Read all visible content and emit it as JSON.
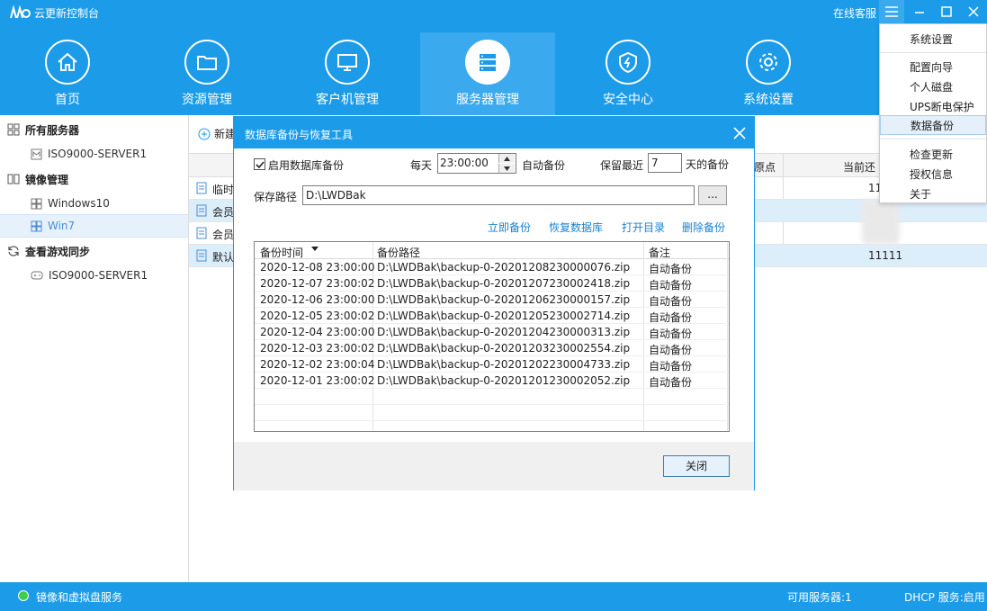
{
  "app": {
    "title": "云更新控制台",
    "online_service": "在线客服"
  },
  "nav": [
    {
      "label": "首页",
      "icon": "home-icon"
    },
    {
      "label": "资源管理",
      "icon": "folder-icon"
    },
    {
      "label": "客户机管理",
      "icon": "monitor-icon"
    },
    {
      "label": "服务器管理",
      "icon": "server-icon",
      "active": true
    },
    {
      "label": "安全中心",
      "icon": "shield-icon"
    },
    {
      "label": "系统设置",
      "icon": "gear-icon"
    }
  ],
  "sidebar": {
    "items": [
      {
        "label": "所有服务器",
        "type": "group"
      },
      {
        "label": "ISO9000-SERVER1",
        "type": "child"
      },
      {
        "label": "镜像管理",
        "type": "group"
      },
      {
        "label": "Windows10",
        "type": "child"
      },
      {
        "label": "Win7",
        "type": "child",
        "selected": true
      },
      {
        "label": "查看游戏同步",
        "type": "group"
      },
      {
        "label": "ISO9000-SERVER1",
        "type": "child"
      }
    ]
  },
  "main": {
    "add_label": "新建",
    "headers": {
      "col_a": "原点",
      "col_b": "当前还"
    },
    "rows": [
      {
        "name": "临时",
        "value": "11"
      },
      {
        "name": "会员",
        "value": ""
      },
      {
        "name": "会员",
        "value": ""
      },
      {
        "name": "默认",
        "value": "11111"
      }
    ]
  },
  "menu": {
    "items": [
      {
        "label": "系统设置"
      },
      {
        "label": "配置向导"
      },
      {
        "label": "个人磁盘"
      },
      {
        "label": "UPS断电保护"
      },
      {
        "label": "数据备份",
        "highlighted": true
      },
      {
        "label": "检查更新"
      },
      {
        "label": "授权信息"
      },
      {
        "label": "关于"
      }
    ]
  },
  "dialog": {
    "title": "数据库备份与恢复工具",
    "enable_label": "启用数据库备份",
    "enabled": true,
    "daily_label": "每天",
    "time_value": "23:00:00",
    "auto_backup_label": "自动备份",
    "keep_recent_label": "保留最近",
    "keep_value": "7",
    "days_backup_label": "天的备份",
    "save_path_label": "保存路径",
    "save_path_value": "D:\\LWDBak",
    "browse_label": "...",
    "actions": [
      "立即备份",
      "恢复数据库",
      "打开目录",
      "删除备份"
    ],
    "columns": [
      "备份时间",
      "备份路径",
      "备注"
    ],
    "rows": [
      {
        "time": "2020-12-08 23:00:00",
        "path": "D:\\LWDBak\\backup-0-20201208230000076.zip",
        "note": "自动备份"
      },
      {
        "time": "2020-12-07 23:00:02",
        "path": "D:\\LWDBak\\backup-0-20201207230002418.zip",
        "note": "自动备份"
      },
      {
        "time": "2020-12-06 23:00:00",
        "path": "D:\\LWDBak\\backup-0-20201206230000157.zip",
        "note": "自动备份"
      },
      {
        "time": "2020-12-05 23:00:02",
        "path": "D:\\LWDBak\\backup-0-20201205230002714.zip",
        "note": "自动备份"
      },
      {
        "time": "2020-12-04 23:00:00",
        "path": "D:\\LWDBak\\backup-0-20201204230000313.zip",
        "note": "自动备份"
      },
      {
        "time": "2020-12-03 23:00:02",
        "path": "D:\\LWDBak\\backup-0-20201203230002554.zip",
        "note": "自动备份"
      },
      {
        "time": "2020-12-02 23:00:04",
        "path": "D:\\LWDBak\\backup-0-20201202230004733.zip",
        "note": "自动备份"
      },
      {
        "time": "2020-12-01 23:00:02",
        "path": "D:\\LWDBak\\backup-0-20201201230002052.zip",
        "note": "自动备份"
      }
    ],
    "close_label": "关闭"
  },
  "status": {
    "left": "镜像和虚拟盘服务",
    "servers": "可用服务器:1",
    "dhcp": "DHCP 服务:启用"
  },
  "colors": {
    "brand": "#1b9be8",
    "link": "#1a82d0",
    "status_ok": "#3cd04a"
  }
}
